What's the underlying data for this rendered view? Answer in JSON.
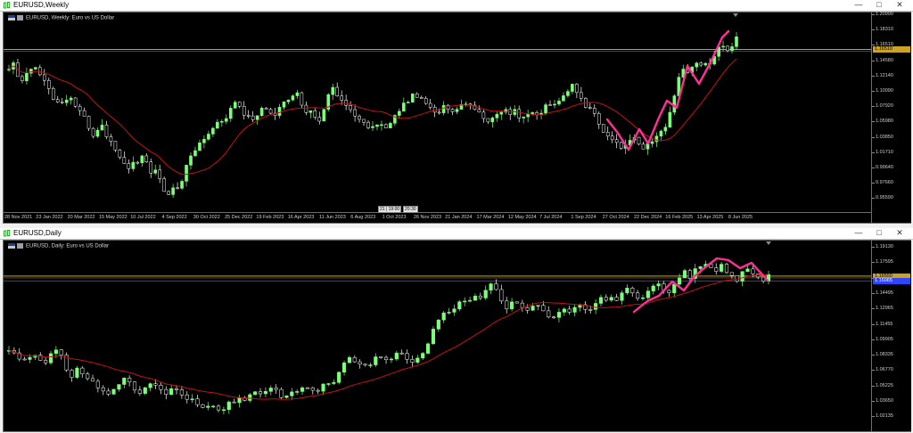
{
  "weekly": {
    "window_title": "EURUSD,Weekly",
    "chart_label": "EURUSD, Weekly:  Euro vs US Dollar",
    "price_ticks": [
      "1.20900",
      "1.18310",
      "1.16510",
      "1.14580",
      "1.12140",
      "1.10090",
      "1.07920",
      "1.05980",
      "1.03850",
      "1.01710",
      "0.99640",
      "0.97660",
      "0.95590"
    ],
    "price_box_gold": "1.16510",
    "time_ticks": [
      "28 Nov 2021",
      "23 Jan 2022",
      "20 Mar 2022",
      "15 May 2022",
      "10 Jul 2022",
      "4 Sep 2022",
      "30 Oct 2022",
      "25 Dec 2022",
      "19 Feb 2023",
      "16 Apr 2023",
      "11 Jun 2023",
      "6 Aug 2023",
      "1 Oct 2023",
      "26 Nov 2023",
      "21 Jan 2024",
      "17 Mar 2024",
      "12 May 2024",
      "7 Jul 2024",
      "1 Sep 2024",
      "27 Oct 2024",
      "22 Dec 2024",
      "16 Feb 2025",
      "13 Apr 2025",
      "8 Jun 2025"
    ],
    "crosshair_tags": [
      "21 | 19:00",
      "20:30"
    ],
    "trend_seed": [
      1.136,
      1.145,
      1.129,
      1.122,
      1.133,
      1.144,
      1.14,
      1.124,
      1.121,
      1.105,
      1.091,
      1.092,
      1.098,
      1.101,
      1.09,
      1.085,
      1.073,
      1.058,
      1.047,
      1.062,
      1.06,
      1.043,
      1.036,
      1.024,
      1.018,
      1.0,
      1.013,
      1.007,
      1.025,
      1.017,
      0.998,
      1.005,
      0.986,
      0.972,
      0.967,
      0.981,
      0.972,
      0.998,
      1.018,
      1.025,
      1.034,
      1.042,
      1.049,
      1.058,
      1.069,
      1.066,
      1.074,
      1.088,
      1.093,
      1.085,
      1.07,
      1.074,
      1.065,
      1.081,
      1.089,
      1.078,
      1.073,
      1.085,
      1.096,
      1.097,
      1.101,
      1.106,
      1.091,
      1.076,
      1.08,
      1.073,
      1.066,
      1.094,
      1.115,
      1.108,
      1.097,
      1.091,
      1.086,
      1.08,
      1.07,
      1.065,
      1.061,
      1.058,
      1.066,
      1.062,
      1.057,
      1.067,
      1.077,
      1.087,
      1.094,
      1.098,
      1.107,
      1.097,
      1.094,
      1.087,
      1.078,
      1.081,
      1.09,
      1.087,
      1.082,
      1.085,
      1.096,
      1.091,
      1.092,
      1.081,
      1.077,
      1.071,
      1.067,
      1.075,
      1.082,
      1.086,
      1.079,
      1.085,
      1.073,
      1.071,
      1.077,
      1.081,
      1.074,
      1.083,
      1.091,
      1.087,
      1.094,
      1.101,
      1.108,
      1.118,
      1.111,
      1.104,
      1.089,
      1.087,
      1.075,
      1.062,
      1.052,
      1.048,
      1.041,
      1.035,
      1.029,
      1.043,
      1.047,
      1.04,
      1.029,
      1.035,
      1.038,
      1.048,
      1.052,
      1.058,
      1.083,
      1.106,
      1.132,
      1.139,
      1.128,
      1.15,
      1.139,
      1.148,
      1.14,
      1.156,
      1.164,
      1.171,
      1.162,
      1.169,
      1.181
    ],
    "colors": {
      "bull": "#7cff78",
      "bear": "#ffffff",
      "ma": "#c81010",
      "gold": "#c9a227",
      "blue": "#2f45ff",
      "pattern": "#ff2f97"
    }
  },
  "daily": {
    "window_title": "EURUSD,Daily",
    "chart_label": "EURUSD, Daily:  Euro vs US Dollar",
    "price_ticks": [
      "1.19130",
      "1.17595",
      "1.16065",
      "1.14495",
      "1.12965",
      "1.11455",
      "1.09905",
      "1.08335",
      "1.06770",
      "1.05225",
      "1.03650",
      "1.02135"
    ],
    "price_box_gold": "1.16550",
    "price_box_blue": "1.16065",
    "trend_seed": [
      1.089,
      1.086,
      1.083,
      1.081,
      1.083,
      1.085,
      1.082,
      1.079,
      1.086,
      1.09,
      1.087,
      1.07,
      1.064,
      1.072,
      1.067,
      1.061,
      1.058,
      1.053,
      1.049,
      1.047,
      1.051,
      1.058,
      1.062,
      1.056,
      1.05,
      1.045,
      1.055,
      1.059,
      1.054,
      1.05,
      1.047,
      1.052,
      1.049,
      1.044,
      1.04,
      1.042,
      1.036,
      1.032,
      1.037,
      1.031,
      1.028,
      1.034,
      1.04,
      1.038,
      1.043,
      1.039,
      1.046,
      1.049,
      1.043,
      1.052,
      1.055,
      1.049,
      1.041,
      1.046,
      1.05,
      1.048,
      1.056,
      1.051,
      1.047,
      1.053,
      1.058,
      1.055,
      1.063,
      1.072,
      1.084,
      1.081,
      1.076,
      1.079,
      1.073,
      1.08,
      1.085,
      1.081,
      1.078,
      1.085,
      1.089,
      1.083,
      1.077,
      1.083,
      1.081,
      1.091,
      1.106,
      1.118,
      1.125,
      1.131,
      1.128,
      1.135,
      1.145,
      1.138,
      1.147,
      1.142,
      1.149,
      1.155,
      1.158,
      1.144,
      1.132,
      1.138,
      1.141,
      1.136,
      1.129,
      1.133,
      1.138,
      1.13,
      1.126,
      1.121,
      1.127,
      1.132,
      1.128,
      1.133,
      1.138,
      1.135,
      1.13,
      1.137,
      1.143,
      1.14,
      1.146,
      1.139,
      1.147,
      1.153,
      1.15,
      1.144,
      1.141,
      1.148,
      1.156,
      1.16,
      1.153,
      1.147,
      1.158,
      1.165,
      1.171,
      1.164,
      1.172,
      1.176,
      1.178,
      1.174,
      1.17,
      1.177,
      1.171,
      1.165,
      1.161,
      1.169,
      1.172,
      1.168,
      1.163,
      1.16,
      1.166
    ],
    "colors": {
      "bull": "#7cff78",
      "bear": "#ffffff",
      "ma": "#c81010",
      "gold": "#c9a227",
      "blue": "#2f45ff",
      "pattern": "#ff2f97"
    }
  },
  "buttons": {
    "minimize": "—",
    "maximize": "□",
    "close": "✕"
  }
}
